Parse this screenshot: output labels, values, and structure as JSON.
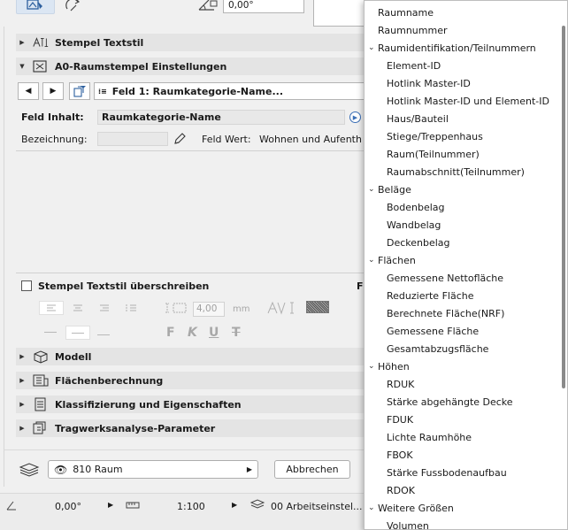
{
  "top": {
    "angle_value": "0,00°"
  },
  "sections": {
    "stamp_textstyle": "Stempel Textstil",
    "zone_stamp_settings": "A0-Raumstempel Einstellungen",
    "model": "Modell",
    "area_calc": "Flächenberechnung",
    "classification": "Klassifizierung und Eigenschaften",
    "structural": "Tragwerksanalyse-Parameter"
  },
  "field_selector": {
    "value": "Feld 1: Raumkategorie-Name..."
  },
  "field_content": {
    "label": "Feld Inhalt:",
    "value": "Raumkategorie-Name"
  },
  "designation": {
    "label": "Bezeichnung:",
    "field_value_label": "Feld Wert:",
    "field_value": "Wohnen und Aufenthalt"
  },
  "override": {
    "label": "Stempel Textstil überschreiben",
    "letter_f": "F",
    "size_value": "4,00",
    "size_unit": "mm",
    "bold": "F",
    "italic": "K",
    "underline": "U",
    "strike": "T"
  },
  "footer": {
    "view_value": "810 Raum",
    "cancel": "Abbrechen"
  },
  "status": {
    "angle": "0,00°",
    "scale": "1:100",
    "layer": "00 Arbeitseinstel..."
  },
  "menu": {
    "items": [
      {
        "label": "Raumname",
        "level": 0
      },
      {
        "label": "Raumnummer",
        "level": 0
      },
      {
        "label": "Raumidentifikation/Teilnummern",
        "level": 0,
        "group": true
      },
      {
        "label": "Element-ID",
        "level": 1
      },
      {
        "label": "Hotlink Master-ID",
        "level": 1
      },
      {
        "label": "Hotlink Master-ID und Element-ID",
        "level": 1
      },
      {
        "label": "Haus/Bauteil",
        "level": 1
      },
      {
        "label": "Stiege/Treppenhaus",
        "level": 1
      },
      {
        "label": "Raum(Teilnummer)",
        "level": 1
      },
      {
        "label": "Raumabschnitt(Teilnummer)",
        "level": 1
      },
      {
        "label": "Beläge",
        "level": 0,
        "group": true
      },
      {
        "label": "Bodenbelag",
        "level": 1
      },
      {
        "label": "Wandbelag",
        "level": 1
      },
      {
        "label": "Deckenbelag",
        "level": 1
      },
      {
        "label": "Flächen",
        "level": 0,
        "group": true
      },
      {
        "label": "Gemessene Nettofläche",
        "level": 1
      },
      {
        "label": "Reduzierte Fläche",
        "level": 1
      },
      {
        "label": "Berechnete Fläche(NRF)",
        "level": 1
      },
      {
        "label": "Gemessene Fläche",
        "level": 1
      },
      {
        "label": "Gesamtabzugsfläche",
        "level": 1
      },
      {
        "label": "Höhen",
        "level": 0,
        "group": true
      },
      {
        "label": "RDUK",
        "level": 1
      },
      {
        "label": "Stärke abgehängte Decke",
        "level": 1
      },
      {
        "label": "FDUK",
        "level": 1
      },
      {
        "label": "Lichte Raumhöhe",
        "level": 1
      },
      {
        "label": "FBOK",
        "level": 1
      },
      {
        "label": "Stärke Fussbodenaufbau",
        "level": 1
      },
      {
        "label": "RDOK",
        "level": 1
      },
      {
        "label": "Weitere Größen",
        "level": 0,
        "group": true
      },
      {
        "label": "Volumen",
        "level": 1
      }
    ]
  }
}
